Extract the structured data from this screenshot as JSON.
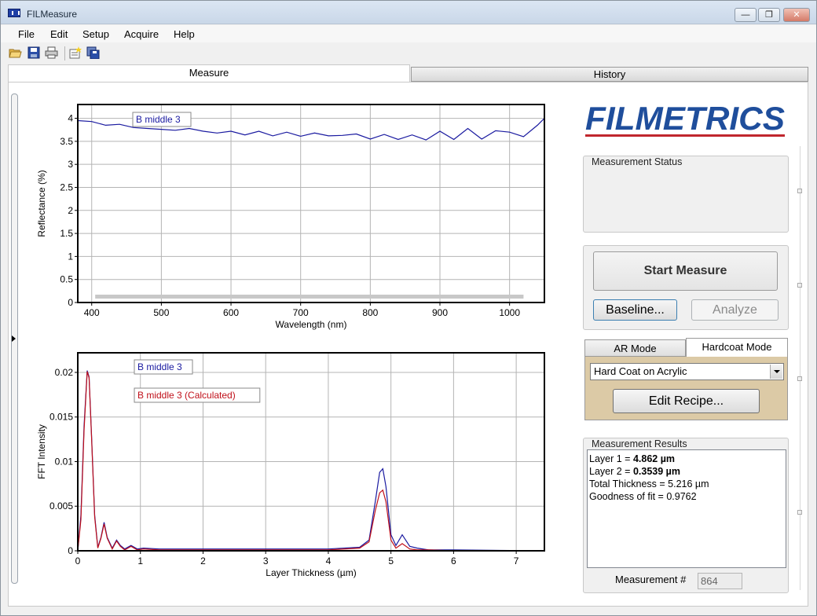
{
  "window": {
    "title": "FILMeasure"
  },
  "menu": [
    "File",
    "Edit",
    "Setup",
    "Acquire",
    "Help"
  ],
  "tabs": {
    "measure": "Measure",
    "history": "History"
  },
  "logo": {
    "text": "FILMETRICS",
    "color": "#1f4e9c",
    "accent": "#c0262d"
  },
  "chart_data": [
    {
      "type": "line",
      "title": "",
      "xlabel": "Wavelength (nm)",
      "ylabel": "Reflectance (%)",
      "xlim": [
        380,
        1050
      ],
      "ylim": [
        0,
        4.3
      ],
      "xticks": [
        400,
        500,
        600,
        700,
        800,
        900,
        1000
      ],
      "yticks": [
        0,
        0.5,
        1,
        1.5,
        2,
        2.5,
        3,
        3.5,
        4
      ],
      "grid": true,
      "legend_position": "top-left",
      "series": [
        {
          "name": "B middle 3",
          "color": "#1a1aa0",
          "x": [
            380,
            400,
            420,
            440,
            460,
            480,
            500,
            520,
            540,
            560,
            580,
            600,
            620,
            640,
            660,
            680,
            700,
            720,
            740,
            760,
            780,
            800,
            820,
            840,
            860,
            880,
            900,
            920,
            940,
            960,
            980,
            1000,
            1020,
            1040,
            1050
          ],
          "y": [
            3.95,
            3.93,
            3.85,
            3.87,
            3.8,
            3.78,
            3.76,
            3.74,
            3.78,
            3.72,
            3.68,
            3.72,
            3.64,
            3.72,
            3.62,
            3.7,
            3.61,
            3.68,
            3.62,
            3.63,
            3.66,
            3.55,
            3.65,
            3.54,
            3.64,
            3.53,
            3.72,
            3.54,
            3.78,
            3.55,
            3.73,
            3.7,
            3.6,
            3.85,
            4.0
          ]
        }
      ],
      "range_bar": {
        "from": 405,
        "to": 1020,
        "color": "#c8c8c8"
      }
    },
    {
      "type": "line",
      "title": "",
      "xlabel": "Layer Thickness (µm)",
      "ylabel": "FFT Intensity",
      "xlim": [
        0,
        7.45
      ],
      "ylim": [
        0,
        0.0222
      ],
      "xticks": [
        0,
        1,
        2,
        3,
        4,
        5,
        6,
        7
      ],
      "yticks": [
        0,
        0.005,
        0.01,
        0.015,
        0.02
      ],
      "yticklabels": [
        "0",
        "0.005",
        "0.01",
        "0.015",
        "0.02"
      ],
      "grid": true,
      "legend_position": "top-left",
      "series": [
        {
          "name": "B middle 3",
          "color": "#1a1aa0",
          "x": [
            0,
            0.05,
            0.1,
            0.15,
            0.18,
            0.22,
            0.27,
            0.32,
            0.37,
            0.42,
            0.47,
            0.55,
            0.62,
            0.68,
            0.75,
            0.85,
            0.95,
            1.05,
            1.3,
            2.0,
            3.0,
            4.0,
            4.5,
            4.65,
            4.75,
            4.82,
            4.87,
            4.92,
            5.0,
            5.08,
            5.18,
            5.3,
            5.42,
            5.6,
            6.0,
            7.45
          ],
          "y": [
            0.0,
            0.004,
            0.014,
            0.0202,
            0.0195,
            0.013,
            0.004,
            0.0004,
            0.0015,
            0.0032,
            0.0015,
            0.0003,
            0.0012,
            0.0006,
            0.0002,
            0.0006,
            0.0002,
            0.0003,
            0.0002,
            0.0002,
            0.0002,
            0.0002,
            0.0004,
            0.0012,
            0.0055,
            0.0088,
            0.0092,
            0.0072,
            0.0018,
            0.0006,
            0.0018,
            0.0005,
            0.0003,
            0.0001,
            0.0001,
            0.0
          ]
        },
        {
          "name": "B middle 3 (Calculated)",
          "color": "#c0101a",
          "x": [
            0,
            0.05,
            0.1,
            0.15,
            0.18,
            0.22,
            0.27,
            0.32,
            0.37,
            0.42,
            0.47,
            0.55,
            0.62,
            0.68,
            0.75,
            0.85,
            0.95,
            1.05,
            1.3,
            2.0,
            3.0,
            4.0,
            4.5,
            4.65,
            4.75,
            4.82,
            4.87,
            4.92,
            5.0,
            5.08,
            5.18,
            5.3,
            5.42,
            5.6,
            6.0,
            7.45
          ],
          "y": [
            0.0,
            0.0035,
            0.0135,
            0.0201,
            0.0194,
            0.0128,
            0.0038,
            0.0003,
            0.0014,
            0.003,
            0.0014,
            0.0002,
            0.0011,
            0.0005,
            0.0001,
            0.0005,
            0.0001,
            0.0002,
            0.0001,
            0.0001,
            0.0001,
            0.0001,
            0.0003,
            0.001,
            0.0045,
            0.0065,
            0.0068,
            0.0055,
            0.0012,
            0.0003,
            0.0008,
            0.0002,
            0.0001,
            0.0001,
            0.0,
            0.0
          ]
        }
      ]
    }
  ],
  "status_panel": {
    "title": "Measurement Status",
    "text": ""
  },
  "buttons": {
    "start": "Start Measure",
    "baseline": "Baseline...",
    "analyze": "Analyze",
    "edit_recipe": "Edit Recipe..."
  },
  "modes": {
    "ar": "AR Mode",
    "hardcoat": "Hardcoat Mode"
  },
  "recipe": {
    "selected": "Hard Coat on Acrylic"
  },
  "results": {
    "title": "Measurement Results",
    "layer1_label": "Layer 1 = ",
    "layer1_value": "4.862 µm",
    "layer2_label": "Layer 2 = ",
    "layer2_value": "0.3539 µm",
    "total": "Total Thickness = 5.216 µm",
    "fit": "Goodness of fit = 0.9762"
  },
  "measurement_number": {
    "label": "Measurement #",
    "value": "864"
  },
  "colors": {
    "recipe_panel_bg": "#dccaa6",
    "plot_grid": "#b4b4b4"
  }
}
